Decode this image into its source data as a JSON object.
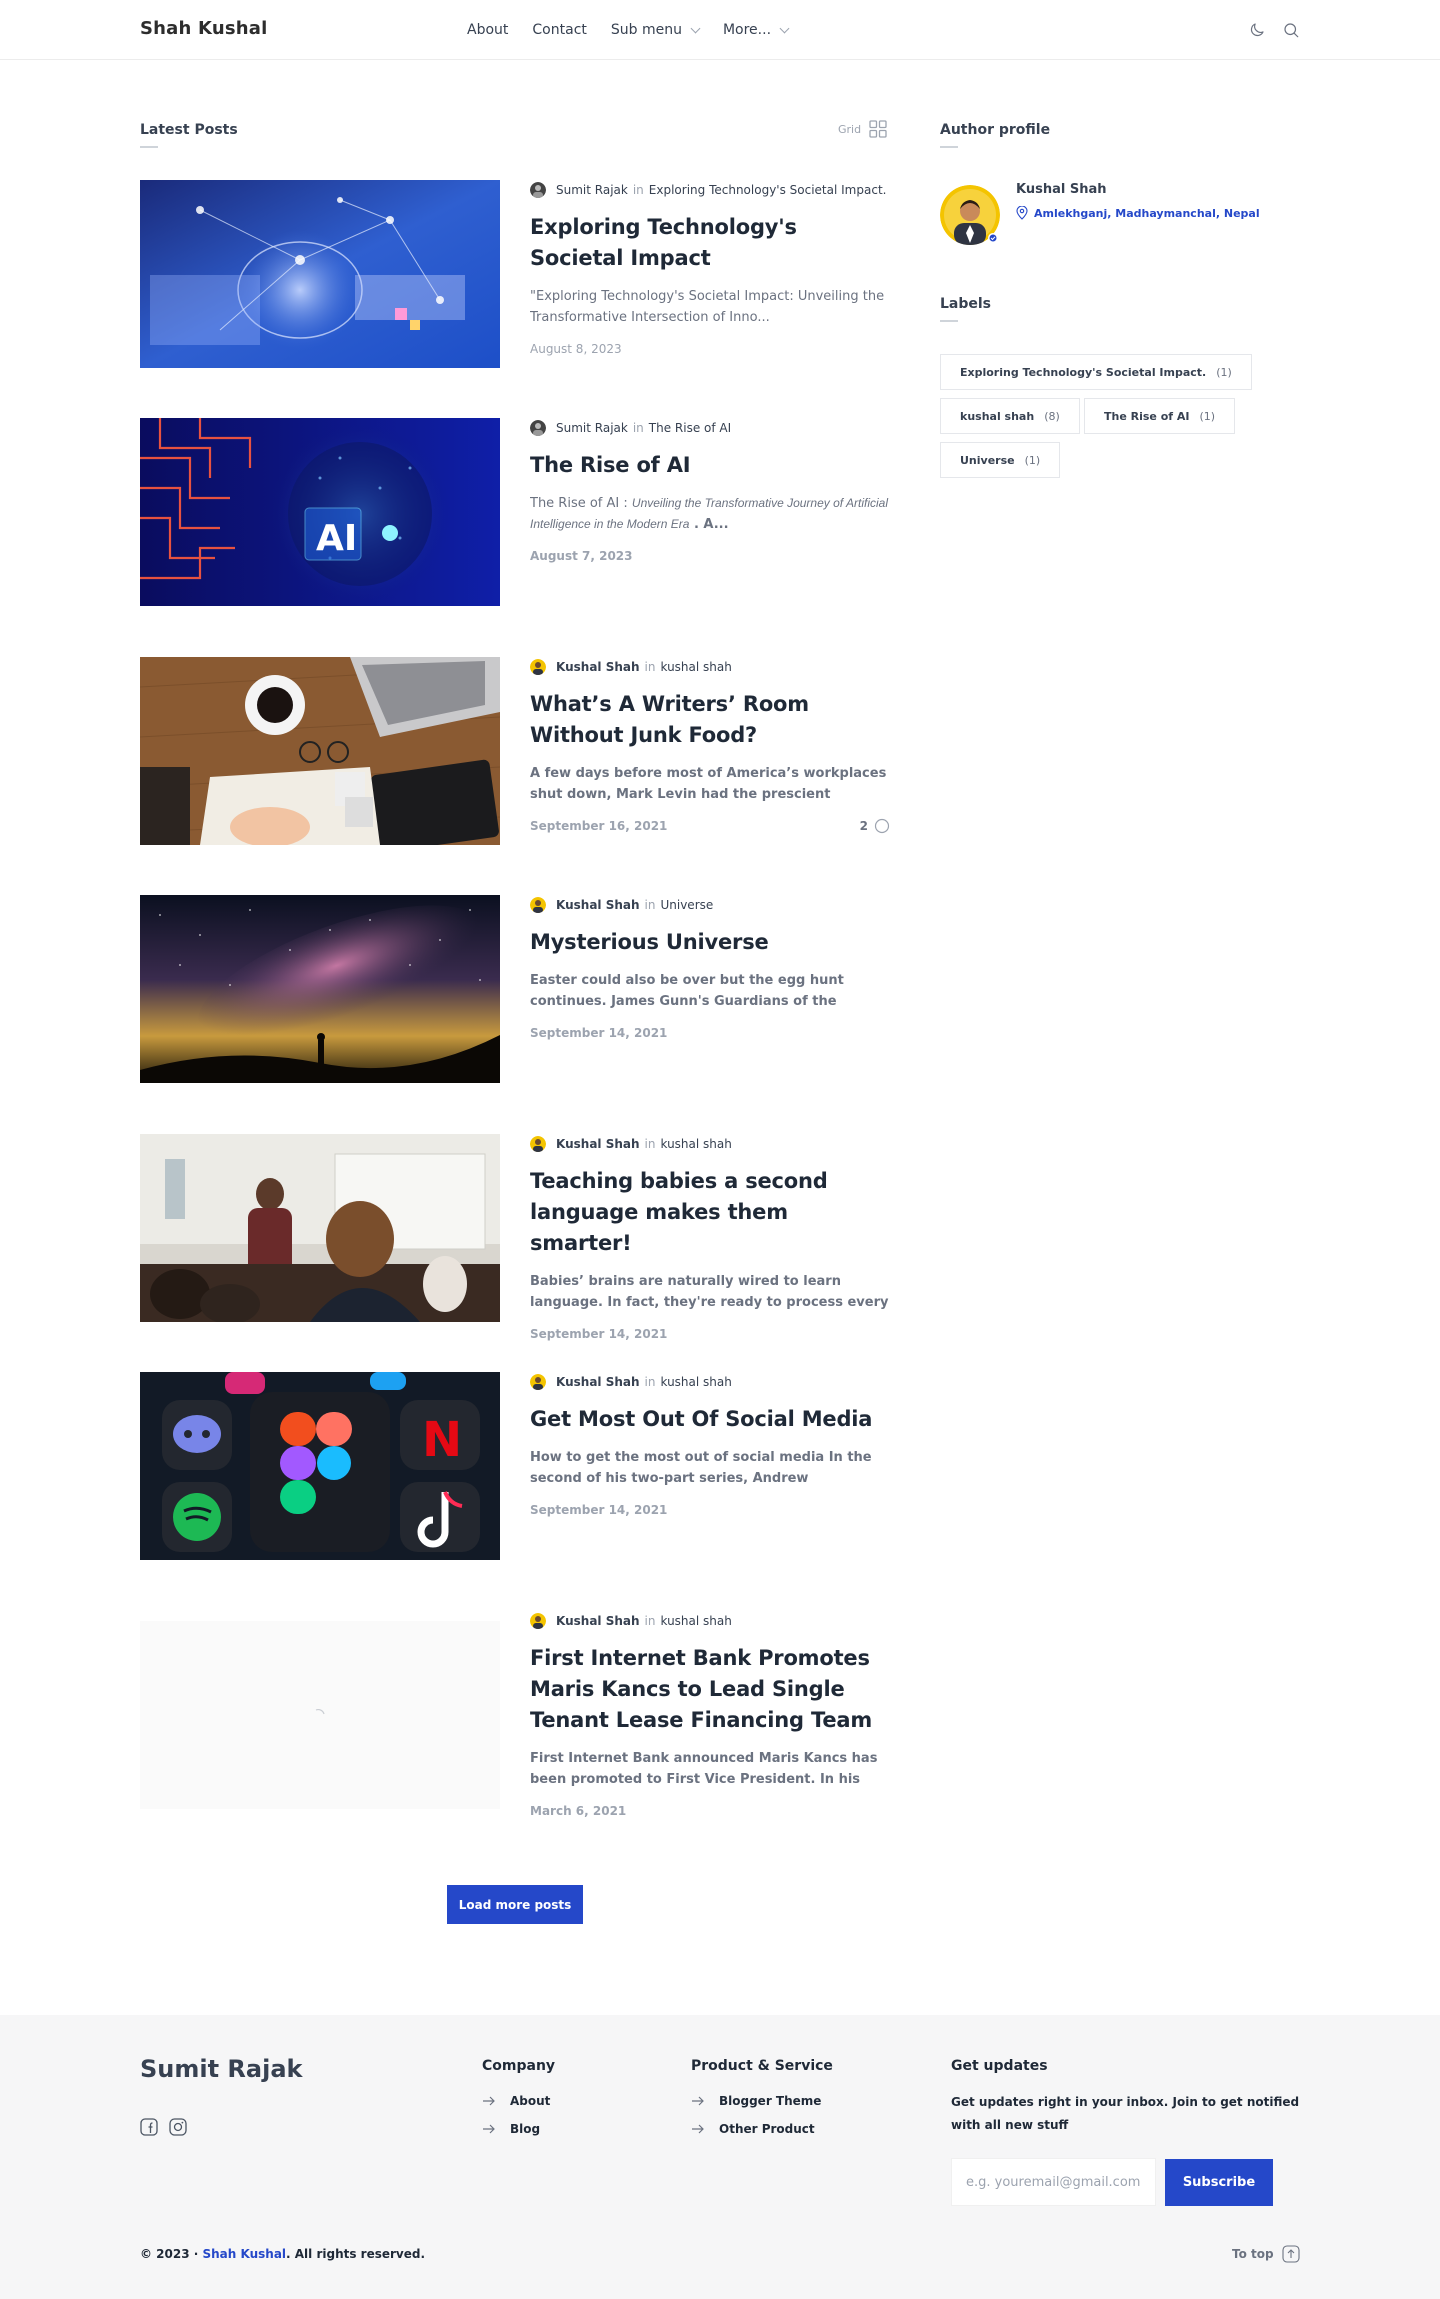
{
  "header": {
    "brand": "Shah Kushal",
    "nav": [
      {
        "label": "About",
        "dropdown": false
      },
      {
        "label": "Contact",
        "dropdown": false
      },
      {
        "label": "Sub menu",
        "dropdown": true
      },
      {
        "label": "More...",
        "dropdown": true
      }
    ],
    "icons": [
      "moon-icon",
      "search-icon"
    ]
  },
  "main": {
    "section_title": "Latest Posts",
    "view_toggle_label": "Grid",
    "posts": [
      {
        "author": "Sumit Rajak",
        "author_bold": false,
        "in": "in",
        "label": "Exploring Technology's Societal Impact.",
        "title": "Exploring Technology's Societal Impact",
        "snippet": "\"Exploring Technology's Societal Impact: Unveiling the Transformative Intersection of Inno...",
        "snippet_bold": false,
        "date": "August 8, 2023",
        "date_bold": false
      },
      {
        "author": "Sumit Rajak",
        "author_bold": false,
        "in": "in",
        "label": "The Rise of AI",
        "title": "The Rise of AI",
        "snippet_prefix": "The Rise of AI : ",
        "snippet_italic": "Unveiling the Transformative Journey of Artificial Intelligence in the Modern Era",
        "snippet_suffix": " . A...",
        "date": "August 7, 2023",
        "date_bold": true
      },
      {
        "author": "Kushal Shah",
        "author_bold": true,
        "in": "in",
        "label": "kushal shah",
        "title": "What’s A Writers’ Room Without Junk Food?",
        "snippet": "A few days before most of America’s workplaces shut down, Mark Levin had the prescient notion...",
        "snippet_bold": true,
        "date": "September 16, 2021",
        "date_bold": true,
        "comments": "2"
      },
      {
        "author": "Kushal Shah",
        "author_bold": true,
        "in": "in",
        "label": "Universe",
        "title": "Mysterious Universe",
        "snippet": "Easter could also be over but the egg hunt continues. James Gunn's Guardians of the Galaxy...",
        "snippet_bold": true,
        "date": "September 14, 2021",
        "date_bold": true
      },
      {
        "author": "Kushal Shah",
        "author_bold": true,
        "in": "in",
        "label": "kushal shah",
        "title": "Teaching babies a second language makes them smarter!",
        "snippet": "Babies’ brains are naturally wired to learn language. In fact, they're ready to process every s...",
        "snippet_bold": true,
        "date": "September 14, 2021",
        "date_bold": true
      },
      {
        "author": "Kushal Shah",
        "author_bold": true,
        "in": "in",
        "label": "kushal shah",
        "title": "Get Most Out Of Social Media",
        "snippet": "How to get the most out of social media In the second of his two-part series, Andrew Langridge...",
        "snippet_bold": true,
        "date": "September 14, 2021",
        "date_bold": true
      },
      {
        "author": "Kushal Shah",
        "author_bold": true,
        "in": "in",
        "label": "kushal shah",
        "title": "First Internet Bank Promotes Maris Kancs to Lead Single Tenant Lease Financing Team",
        "snippet": "First Internet Bank announced Maris Kancs has been promoted to First Vice President. In his new...",
        "snippet_bold": true,
        "date": "March 6, 2021",
        "date_bold": true
      }
    ],
    "load_more": "Load more posts"
  },
  "sidebar": {
    "author_title": "Author profile",
    "author_name": "Kushal Shah",
    "author_location": "Amlekhganj, Madhaymanchal, Nepal",
    "labels_title": "Labels",
    "labels": [
      {
        "name": "Exploring Technology's Societal Impact.",
        "count": "(1)"
      },
      {
        "name": "kushal shah",
        "count": "(8)"
      },
      {
        "name": "The Rise of AI",
        "count": "(1)"
      },
      {
        "name": "Universe",
        "count": "(1)"
      }
    ]
  },
  "footer": {
    "brand": "Sumit Rajak",
    "social_icons": [
      "facebook-icon",
      "instagram-icon"
    ],
    "company_title": "Company",
    "company_links": [
      "About",
      "Blog"
    ],
    "product_title": "Product & Service",
    "product_links": [
      "Blogger Theme",
      "Other Product"
    ],
    "updates_title": "Get updates",
    "updates_text": "Get updates right in your inbox. Join to get notified with all new stuff",
    "email_placeholder": "e.g. youremail@gmail.com",
    "subscribe": "Subscribe",
    "copyright_prefix": "© 2023 · ",
    "copyright_link": "Shah Kushal",
    "copyright_suffix": ". All rights reserved.",
    "to_top": "To top"
  },
  "colors": {
    "accent": "#2548c9",
    "footer_bg": "#f6f6f7"
  }
}
